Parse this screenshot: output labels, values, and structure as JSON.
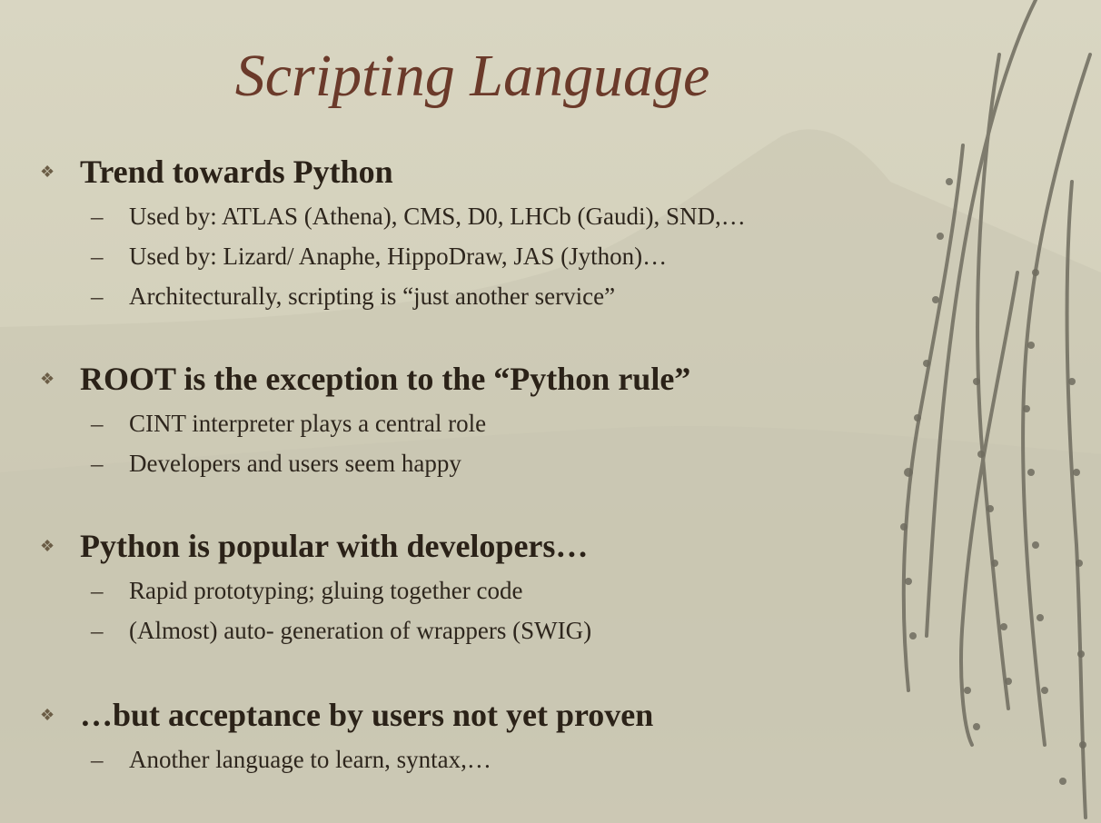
{
  "slide": {
    "title": "Scripting Language",
    "bullet_marker": "❖",
    "sub_marker": "–",
    "bullets": [
      {
        "text": "Trend towards Python",
        "subs": [
          "Used by: ATLAS (Athena), CMS, D0, LHCb (Gaudi), SND,…",
          "Used by: Lizard/ Anaphe, HippoDraw, JAS (Jython)…",
          "Architecturally, scripting is “just another service”"
        ]
      },
      {
        "text": "ROOT is the exception to the “Python rule”",
        "subs": [
          "CINT interpreter plays a central role",
          "Developers and users seem happy"
        ]
      },
      {
        "text": "Python is popular with developers…",
        "subs": [
          "Rapid prototyping; gluing together code",
          "(Almost) auto- generation of wrappers (SWIG)"
        ]
      },
      {
        "text": "…but acceptance by users not yet proven",
        "subs": [
          "Another language to learn, syntax,…"
        ]
      }
    ]
  },
  "colors": {
    "background": "#d6d3be",
    "title": "#6b3a2a",
    "text": "#2b2218",
    "mountain": "#c4c1ac",
    "willow": "#7a7769"
  }
}
